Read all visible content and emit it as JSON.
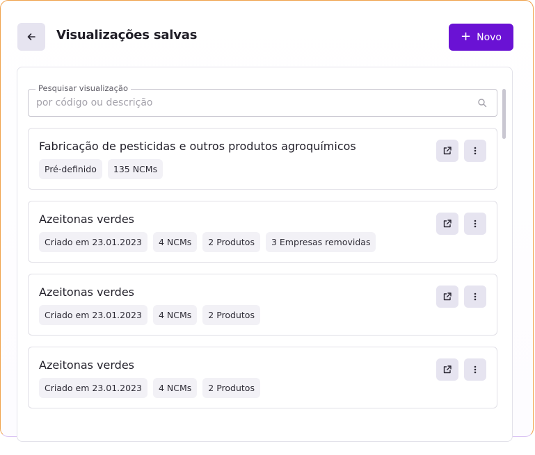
{
  "header": {
    "title": "Visualizações salvas",
    "new_label": "Novo",
    "back_icon": "arrow-left-icon",
    "new_icon": "plus-icon"
  },
  "search": {
    "label": "Pesquisar visualização",
    "placeholder": "por código ou descrição",
    "value": "",
    "icon": "search-icon"
  },
  "cards": [
    {
      "title": "Fabricação de pesticidas e outros produtos agroquímicos",
      "chips": [
        "Pré-definido",
        "135 NCMs"
      ]
    },
    {
      "title": "Azeitonas verdes",
      "chips": [
        "Criado em 23.01.2023",
        "4 NCMs",
        "2 Produtos",
        "3 Empresas removidas"
      ]
    },
    {
      "title": "Azeitonas verdes",
      "chips": [
        "Criado em 23.01.2023",
        "4 NCMs",
        "2 Produtos"
      ]
    },
    {
      "title": "Azeitonas verdes",
      "chips": [
        "Criado em 23.01.2023",
        "4 NCMs",
        "2 Produtos"
      ]
    }
  ],
  "colors": {
    "accent": "#6a12d4",
    "icon_button_bg": "#e6e4f0",
    "chip_bg": "#f2f1f6",
    "panel_border": "#f0a24b"
  }
}
